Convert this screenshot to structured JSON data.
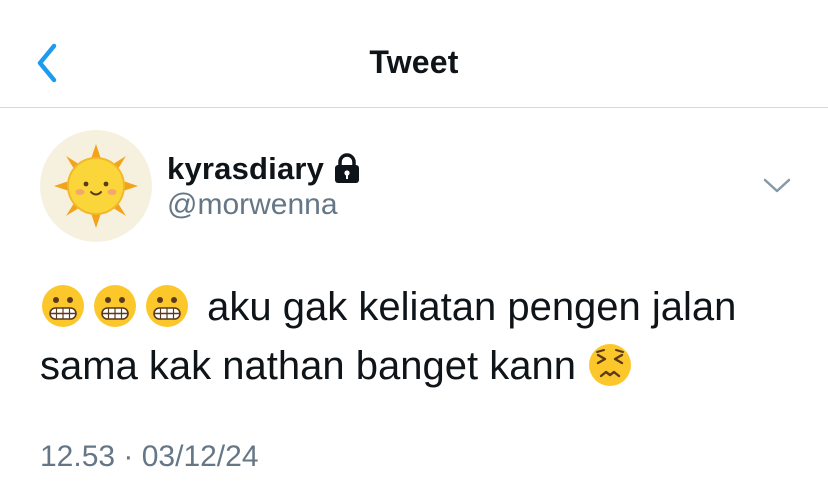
{
  "header": {
    "title": "Tweet"
  },
  "user": {
    "name": "kyrasdiary",
    "handle": "@morwenna"
  },
  "tweet": {
    "text_line1": "aku gak keliatan pengen jalan",
    "text_line2": "sama kak nathan banget kann"
  },
  "timestamp": "12.53 · 03/12/24",
  "icons": {
    "back": "chevron-left-icon",
    "lock": "lock-icon",
    "more": "chevron-down-icon",
    "emoji_prefix": "grimacing-face-emoji",
    "emoji_suffix": "persevering-face-emoji"
  },
  "colors": {
    "accent": "#1d9bf0",
    "secondary_text": "#657786",
    "divider": "#d6d9dc"
  }
}
